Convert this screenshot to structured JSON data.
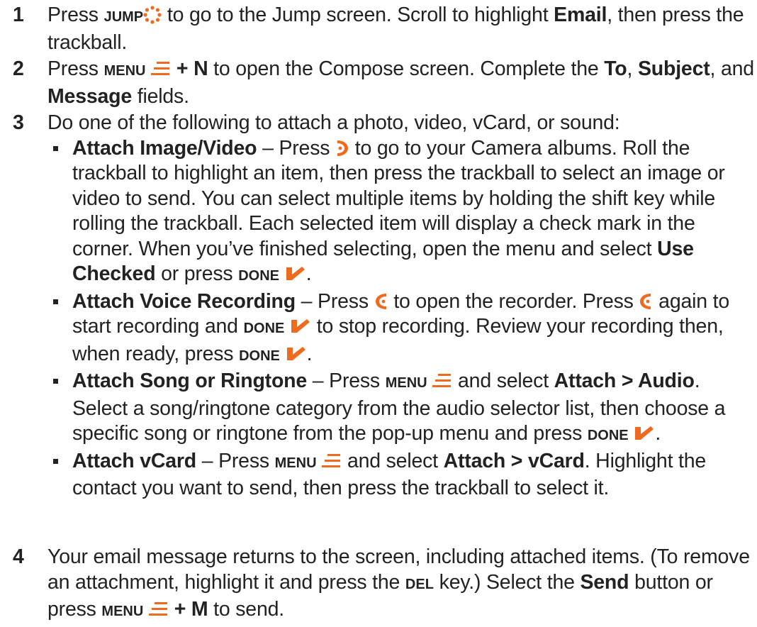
{
  "colors": {
    "text": "#222222",
    "accent": "#ee6a1f"
  },
  "icons": {
    "jump": "jump-icon",
    "menu": "menu-icon",
    "done": "done-check-icon",
    "camera": "camera-album-icon",
    "voice": "voice-recorder-icon"
  },
  "keys": {
    "jump": "JUMP",
    "menu": "MENU",
    "done": "DONE",
    "del": "DEL"
  },
  "steps": [
    {
      "number": "1",
      "t1": "Press ",
      "t2": " to go to the Jump screen. Scroll to highlight ",
      "b1": "Email",
      "t3": ", then press the trackball."
    },
    {
      "number": "2",
      "t1": "Press ",
      "b1": " + N",
      "t2": " to open the Compose screen. Complete the ",
      "b2": "To",
      "t3": ", ",
      "b3": "Subject",
      "t4": ", and ",
      "b4": "Message",
      "t5": " fields."
    },
    {
      "number": "3",
      "intro": "Do one of the following to attach a photo, video, vCard, or sound:",
      "options": [
        {
          "title": "Attach Image/Video",
          "t1": " – Press ",
          "t2": " to go to your Camera albums. Roll the trackball to highlight an item, then press the trackball to select an image or video to send. You can select multiple items by holding the shift key while rolling the trackball. Each selected item will display a check mark in the corner. When you’ve finished selecting, open the menu and select ",
          "b1": "Use Checked",
          "t3": " or press ",
          "t4": "."
        },
        {
          "title": "Attach Voice Recording",
          "t1": " – Press ",
          "t2": " to open the recorder. Press ",
          "t3": " again to start recording and ",
          "t4": " to stop recording. Review your recording then, when ready, press ",
          "t5": "."
        },
        {
          "title": "Attach Song or Ringtone",
          "t1": " – Press ",
          "t2": " and select ",
          "b1": "Attach > Audio",
          "t3": ". Select a song/ringtone category from the audio selector list, then choose a specific song or ringtone from the pop-up menu and press ",
          "t4": "."
        },
        {
          "title": "Attach vCard",
          "t1": " – Press ",
          "t2": " and select ",
          "b1": "Attach > vCard",
          "t3": ". Highlight the contact you want to send, then press the trackball to select it."
        }
      ]
    },
    {
      "number": "4",
      "t1": "Your email message returns to the screen, including attached items. (To remove an attachment, highlight it and press the ",
      "t2": " key.) Select the ",
      "b1": "Send",
      "t3": " button or press ",
      "b2": " + M",
      "t4": " to send."
    }
  ]
}
